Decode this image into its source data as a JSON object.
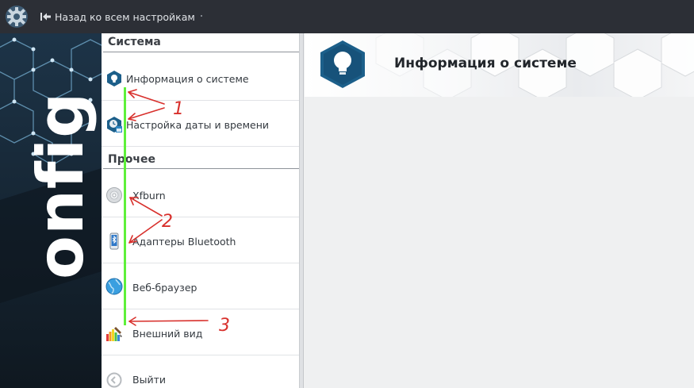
{
  "topbar": {
    "back_label": "Назад ко всем настройкам"
  },
  "decor": {
    "word": "onfig"
  },
  "sections": {
    "system_title": "Система",
    "other_title": "Прочее"
  },
  "items": {
    "system_info": "Информация о системе",
    "datetime": "Настройка даты и времени",
    "xfburn": "Xfburn",
    "bluetooth": "Адаптеры Bluetooth",
    "browser": "Веб-браузер",
    "appearance": "Внешний вид",
    "exit": "Выйти"
  },
  "content": {
    "title": "Информация о системе"
  },
  "annotations": {
    "mark1": "1",
    "mark2": "2",
    "mark3": "3"
  },
  "colors": {
    "topbar": "#2c2f36",
    "accent_green": "#5ef03a",
    "annotation_red": "#d8302c",
    "hex_blue": "#1c5f8a"
  }
}
